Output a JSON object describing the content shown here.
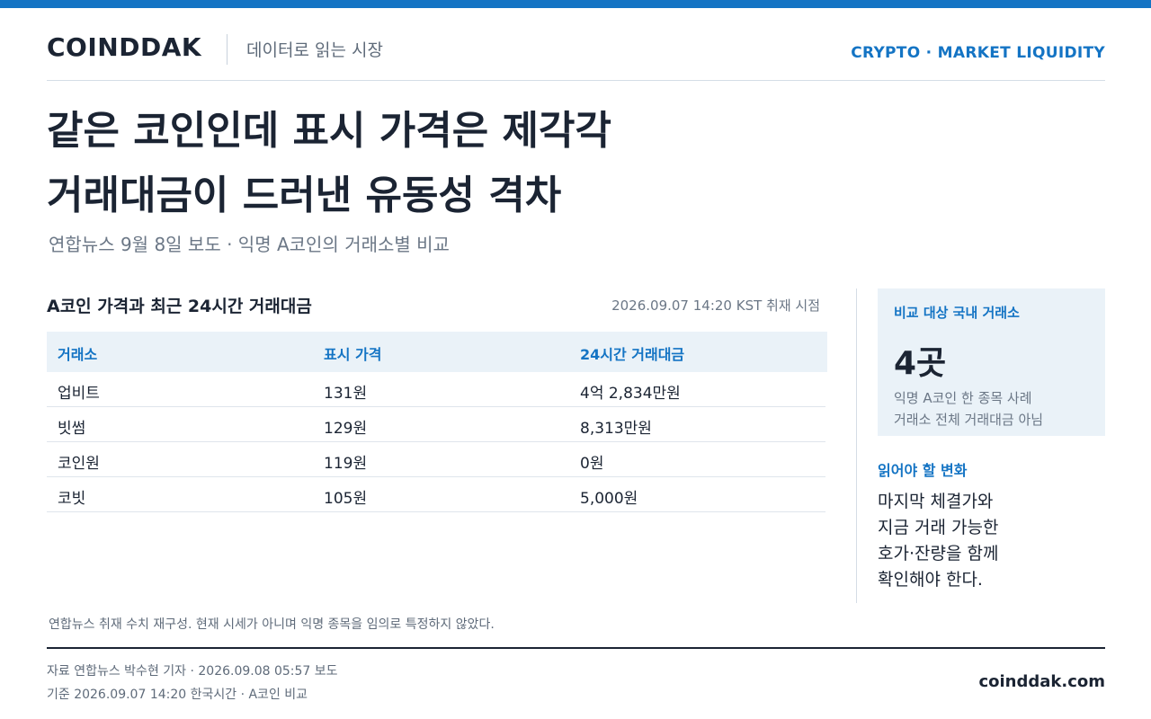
{
  "header": {
    "logo": "COINDDAK",
    "tagline": "데이터로 읽는 시장",
    "section": "CRYPTO · MARKET LIQUIDITY"
  },
  "headline": {
    "line1": "같은 코인인데 표시 가격은 제각각",
    "line2": "거래대금이 드러낸 유동성 격차"
  },
  "subhead": "연합뉴스 9월 8일 보도 · 익명 A코인의 거래소별 비교",
  "table": {
    "title": "A코인 가격과 최근 24시간 거래대금",
    "timestamp": "2026.09.07 14:20 KST 취재 시점",
    "headers": [
      "거래소",
      "표시 가격",
      "24시간 거래대금"
    ],
    "rows": [
      [
        "업비트",
        "131원",
        "4억 2,834만원"
      ],
      [
        "빗썸",
        "129원",
        "8,313만원"
      ],
      [
        "코인원",
        "119원",
        "0원"
      ],
      [
        "코빗",
        "105원",
        "5,000원"
      ]
    ]
  },
  "note": "연합뉴스 취재 수치 재구성. 현재 시세가 아니며 익명 종목을 임의로 특정하지 않았다.",
  "sidebar": {
    "stat_label": "비교 대상 국내 거래소",
    "stat_value": "4곳",
    "stat_desc_1": "익명 A코인 한 종목 사례",
    "stat_desc_2": "거래소 전체 거래대금 아님",
    "read_label": "읽어야 할 변화",
    "read_lines": [
      "마지막 체결가와",
      "지금 거래 가능한",
      "호가·잔량을 함께",
      "확인해야 한다."
    ]
  },
  "footer": {
    "source": "자료  연합뉴스 박수현 기자 · 2026.09.08 05:57 보도",
    "basis": "기준  2026.09.07 14:20 한국시간 · A코인 비교",
    "domain": "coinddak.com"
  },
  "colors": {
    "accent": "#1474c4",
    "text": "#1b2433",
    "muted": "#6b7786",
    "panel": "#eaf2f8"
  }
}
